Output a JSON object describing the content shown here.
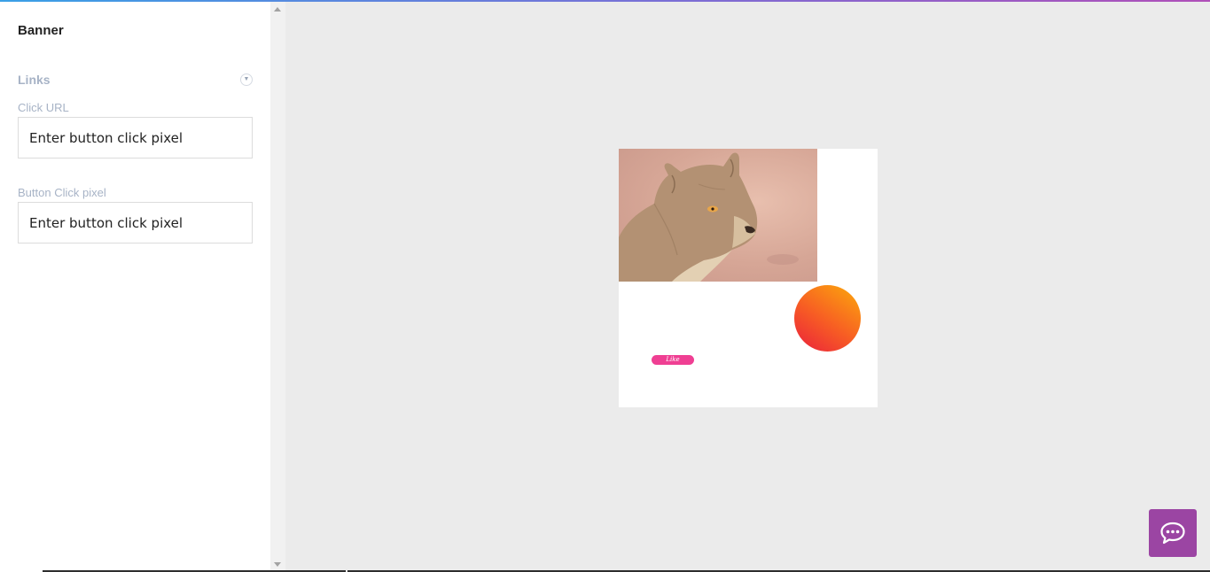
{
  "panel": {
    "title": "Banner",
    "section": {
      "label": "Links",
      "toggle_icon": "chevron-down-icon"
    },
    "fields": [
      {
        "label": "Click URL",
        "placeholder": "Enter button click pixel",
        "value": ""
      },
      {
        "label": "Button Click pixel",
        "placeholder": "Enter button click pixel",
        "value": ""
      }
    ]
  },
  "preview": {
    "image": "lioness-photo",
    "button_label": "Like",
    "colors": {
      "button": "#ef3f93",
      "orb_start": "#ea1f3d",
      "orb_end": "#fcab0b"
    }
  },
  "chat": {
    "icon": "chat-bubble-icon",
    "color": "#9b45a3"
  }
}
